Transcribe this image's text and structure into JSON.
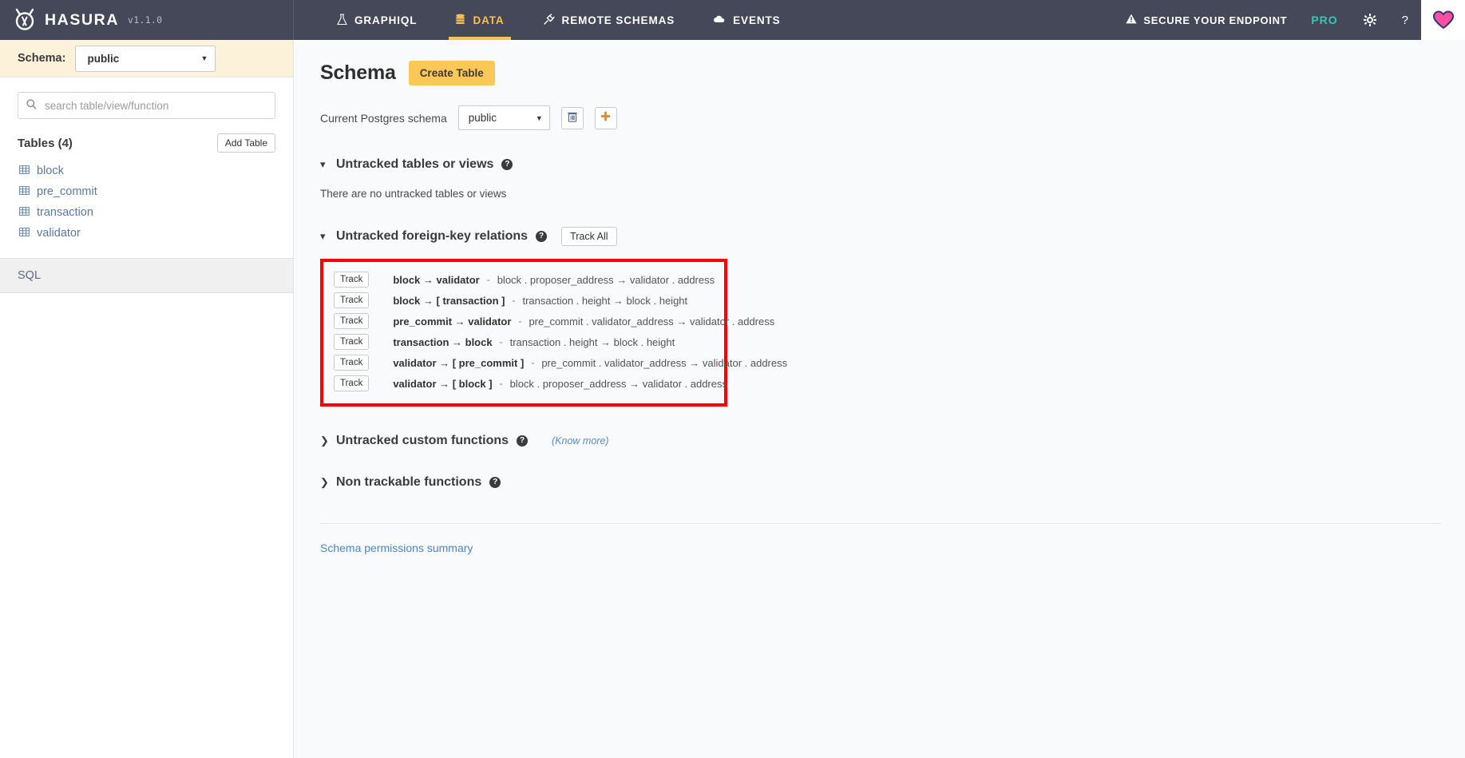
{
  "brand": {
    "logo_icon": "hasura-logo-icon",
    "name": "HASURA",
    "version": "v1.1.0"
  },
  "nav": {
    "tabs": [
      {
        "label": "GRAPHIQL",
        "icon": "flask-icon",
        "glyph": "⚗",
        "active": false
      },
      {
        "label": "DATA",
        "icon": "database-icon",
        "glyph": "≡",
        "active": true
      },
      {
        "label": "REMOTE SCHEMAS",
        "icon": "plug-icon",
        "glyph": "⚡",
        "active": false
      },
      {
        "label": "EVENTS",
        "icon": "cloud-icon",
        "glyph": "☁",
        "active": false
      }
    ],
    "secure_endpoint": {
      "label": "SECURE YOUR ENDPOINT",
      "icon": "warning-icon",
      "glyph": "⚠"
    },
    "pro_label": "PRO",
    "settings_icon": "gear-icon",
    "settings_glyph": "⚙",
    "help_icon": "question-mark-icon",
    "help_glyph": "?",
    "heart_icon": "heart-icon",
    "heart_color": "#ff4fa3"
  },
  "sidebar": {
    "schema_label": "Schema:",
    "schema_value": "public",
    "search": {
      "icon": "search-icon",
      "placeholder": "search table/view/function",
      "value": ""
    },
    "tables_title": "Tables (4)",
    "add_table_label": "Add Table",
    "tables": [
      {
        "name": "block",
        "icon": "table-icon"
      },
      {
        "name": "pre_commit",
        "icon": "table-icon"
      },
      {
        "name": "transaction",
        "icon": "table-icon"
      },
      {
        "name": "validator",
        "icon": "table-icon"
      }
    ],
    "sql_label": "SQL"
  },
  "main": {
    "page_title": "Schema",
    "create_table_label": "Create Table",
    "pg_schema_label": "Current Postgres schema",
    "pg_schema_value": "public",
    "delete_schema_icon": "trash-icon",
    "add_schema_icon": "plus-icon",
    "untracked_tables": {
      "title": "Untracked tables or views",
      "chevron": "chevron-down-icon",
      "help_glyph": "?",
      "empty_message": "There are no untracked tables or views"
    },
    "untracked_fk": {
      "title": "Untracked foreign-key relations",
      "chevron": "chevron-down-icon",
      "help_glyph": "?",
      "track_all_label": "Track All",
      "highlight_color": "#ff0000",
      "track_label": "Track",
      "rows": [
        {
          "relation": "block → validator",
          "detail": "block . proposer_address  →  validator . address"
        },
        {
          "relation": "block → [ transaction ]",
          "detail": "transaction . height  →  block . height"
        },
        {
          "relation": "pre_commit → validator",
          "detail": "pre_commit . validator_address  →  validator . address"
        },
        {
          "relation": "transaction → block",
          "detail": "transaction . height  →  block . height"
        },
        {
          "relation": "validator → [ pre_commit ]",
          "detail": "pre_commit . validator_address  →  validator . address"
        },
        {
          "relation": "validator → [ block ]",
          "detail": "block . proposer_address  →  validator . address"
        }
      ]
    },
    "untracked_functions": {
      "title": "Untracked custom functions",
      "chevron": "chevron-right-icon",
      "help_glyph": "?",
      "know_more_label": "(Know more)"
    },
    "non_trackable_functions": {
      "title": "Non trackable functions",
      "chevron": "chevron-right-icon",
      "help_glyph": "?"
    },
    "permissions_link": "Schema permissions summary"
  }
}
